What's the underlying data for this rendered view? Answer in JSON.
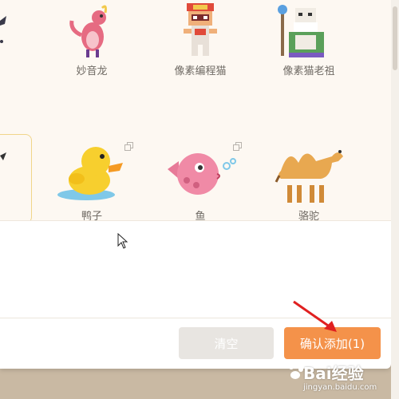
{
  "sprites": {
    "row1": [
      {
        "label": "妙音龙",
        "icon": "pink-dragon-icon"
      },
      {
        "label": "像素编程猫",
        "icon": "pixel-coding-cat-icon"
      },
      {
        "label": "像素猫老祖",
        "icon": "pixel-cat-ancestor-icon"
      }
    ],
    "row2": [
      {
        "label": "鸭子",
        "icon": "duck-icon"
      },
      {
        "label": "鱼",
        "icon": "fish-icon"
      },
      {
        "label": "骆驼",
        "icon": "camel-icon"
      }
    ]
  },
  "buttons": {
    "clear": "清空",
    "confirm": "确认添加(1)"
  },
  "watermark": {
    "main": "Bai经验",
    "sub": "jingyan.baidu.com"
  },
  "colors": {
    "confirm": "#f4924a",
    "clear": "#e8e5e1",
    "annotation_arrow": "#e02020"
  }
}
